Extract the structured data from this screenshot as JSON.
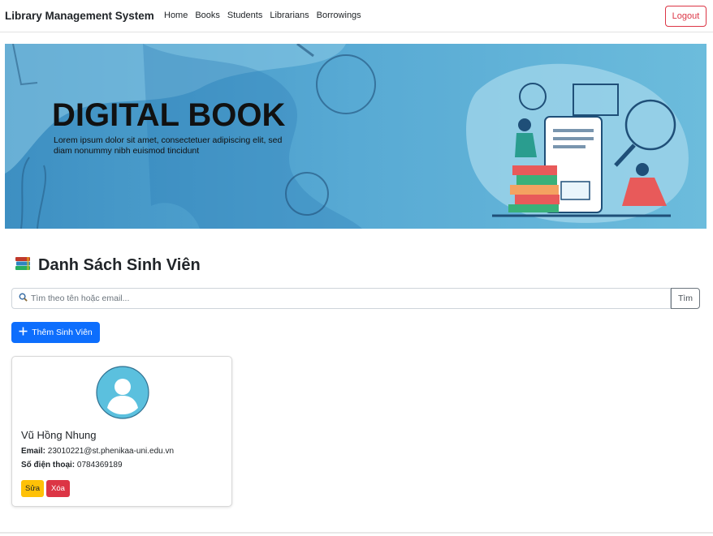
{
  "navbar": {
    "brand": "Library Management System",
    "links": [
      "Home",
      "Books",
      "Students",
      "Librarians",
      "Borrowings"
    ],
    "logout_label": "Logout"
  },
  "banner": {
    "title": "DIGITAL BOOK",
    "text_line1": "Lorem ipsum dolor sit amet, consectetuer adipiscing elit, sed",
    "text_line2": "diam nonummy nibh euismod tincidunt"
  },
  "page": {
    "icon": "books-icon",
    "title": "Danh Sách Sinh Viên"
  },
  "search": {
    "placeholder": "Tìm theo tên hoặc email...",
    "button_label": "Tìm"
  },
  "add_button": {
    "label": "Thêm Sinh Viên"
  },
  "students": [
    {
      "name": "Vũ Hồng Nhung",
      "email_label": "Email:",
      "email": "23010221@st.phenikaa-uni.edu.vn",
      "phone_label": "Số điện thoại:",
      "phone": "0784369189",
      "edit_label": "Sửa",
      "delete_label": "Xóa"
    }
  ],
  "colors": {
    "primary": "#0d6efd",
    "danger": "#dc3545",
    "warning": "#ffc107",
    "banner_blue": "#5aa8cf",
    "avatar_blue": "#5bc0de"
  }
}
